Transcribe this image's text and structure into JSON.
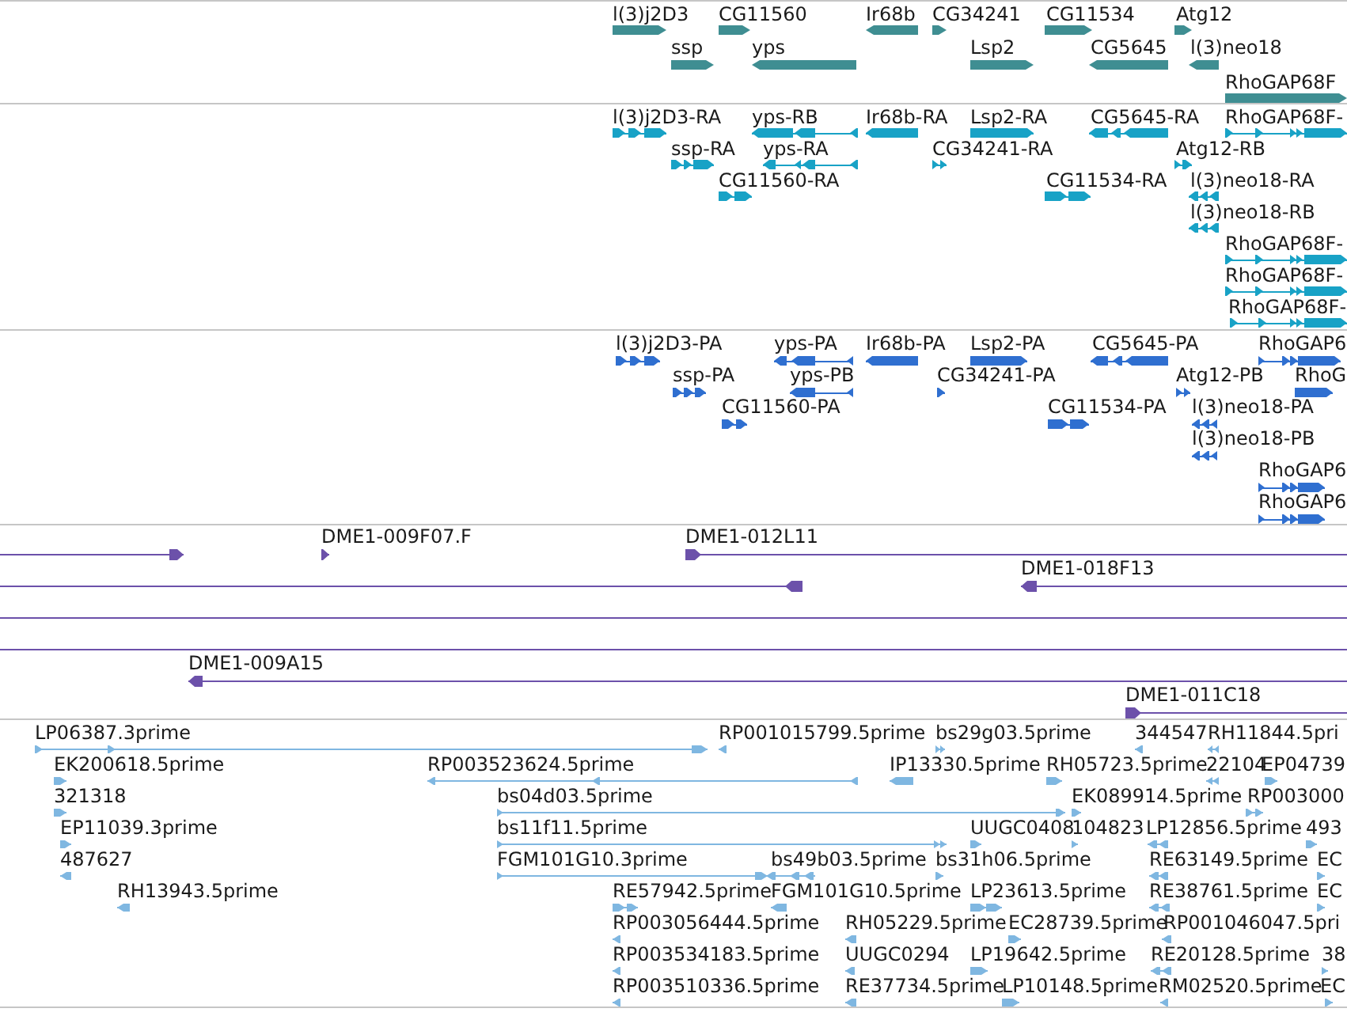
{
  "tracks": [
    {
      "kind": "gene",
      "features": [
        {
          "label": "l(3)j2D3",
          "reverse": false
        },
        {
          "label": "CG11560",
          "reverse": false
        },
        {
          "label": "Ir68b",
          "reverse": true
        },
        {
          "label": "CG34241",
          "reverse": false
        },
        {
          "label": "CG11534",
          "reverse": false
        },
        {
          "label": "Atg12",
          "reverse": false
        },
        {
          "label": "ssp",
          "reverse": false
        },
        {
          "label": "yps",
          "reverse": true
        },
        {
          "label": "Lsp2",
          "reverse": false
        },
        {
          "label": "CG5645",
          "reverse": true
        },
        {
          "label": "l(3)neo18",
          "reverse": true
        },
        {
          "label": "RhoGAP68F",
          "reverse": false
        }
      ]
    },
    {
      "kind": "transcript",
      "features": [
        {
          "label": "l(3)j2D3-RA",
          "reverse": false
        },
        {
          "label": "yps-RB",
          "reverse": true
        },
        {
          "label": "Ir68b-RA",
          "reverse": true
        },
        {
          "label": "Lsp2-RA",
          "reverse": false
        },
        {
          "label": "CG5645-RA",
          "reverse": true
        },
        {
          "label": "RhoGAP68F-",
          "reverse": false
        },
        {
          "label": "ssp-RA",
          "reverse": false
        },
        {
          "label": "yps-RA",
          "reverse": true
        },
        {
          "label": "CG34241-RA",
          "reverse": false
        },
        {
          "label": "Atg12-RB",
          "reverse": false
        },
        {
          "label": "CG11560-RA",
          "reverse": false
        },
        {
          "label": "CG11534-RA",
          "reverse": false
        },
        {
          "label": "l(3)neo18-RA",
          "reverse": true
        },
        {
          "label": "l(3)neo18-RB",
          "reverse": true
        },
        {
          "label": "RhoGAP68F-",
          "reverse": false
        },
        {
          "label": "RhoGAP68F-",
          "reverse": false
        },
        {
          "label": "RhoGAP68F-",
          "reverse": false
        }
      ]
    },
    {
      "kind": "protein",
      "features": [
        {
          "label": "l(3)j2D3-PA",
          "reverse": false
        },
        {
          "label": "yps-PA",
          "reverse": true
        },
        {
          "label": "Ir68b-PA",
          "reverse": true
        },
        {
          "label": "Lsp2-PA",
          "reverse": false
        },
        {
          "label": "CG5645-PA",
          "reverse": true
        },
        {
          "label": "RhoGAP6",
          "reverse": false
        },
        {
          "label": "ssp-PA",
          "reverse": false
        },
        {
          "label": "yps-PB",
          "reverse": true
        },
        {
          "label": "CG34241-PA",
          "reverse": false
        },
        {
          "label": "Atg12-PB",
          "reverse": false
        },
        {
          "label": "RhoG",
          "reverse": false
        },
        {
          "label": "CG11560-PA",
          "reverse": false
        },
        {
          "label": "CG11534-PA",
          "reverse": false
        },
        {
          "label": "l(3)neo18-PA",
          "reverse": true
        },
        {
          "label": "l(3)neo18-PB",
          "reverse": true
        },
        {
          "label": "RhoGAP6",
          "reverse": false
        },
        {
          "label": "RhoGAP6",
          "reverse": false
        }
      ]
    },
    {
      "kind": "clone",
      "features": [
        {
          "kind": "arrow",
          "reverse": false
        },
        {
          "kind": "arrow",
          "label": "DME1-009F07.F",
          "reverse": false
        },
        {
          "kind": "arrow",
          "label": "DME1-012L11",
          "reverse": false
        },
        {
          "kind": "arrow",
          "reverse": true
        },
        {
          "kind": "arrow",
          "label": "DME1-018F13",
          "reverse": true
        },
        {
          "kind": "line"
        },
        {
          "kind": "line"
        },
        {
          "kind": "arrow",
          "label": "DME1-009A15",
          "reverse": true
        },
        {
          "kind": "arrow",
          "label": "DME1-011C18",
          "reverse": false
        }
      ]
    },
    {
      "kind": "est",
      "features": [
        {
          "label": "LP06387.3prime",
          "reverse": false
        },
        {
          "label": "RP001015799.5prime",
          "reverse": true
        },
        {
          "label": "bs29g03.5prime",
          "reverse": false
        },
        {
          "label": "344547",
          "reverse": true
        },
        {
          "label": "RH11844.5pri",
          "reverse": true
        },
        {
          "label": "EK200618.5prime",
          "reverse": false
        },
        {
          "label": "RP003523624.5prime",
          "reverse": true
        },
        {
          "label": "IP13330.5prime",
          "reverse": true
        },
        {
          "label": "RH05723.5prime",
          "reverse": false
        },
        {
          "label": "22104",
          "reverse": true
        },
        {
          "label": "EP04739",
          "reverse": false
        },
        {
          "label": "321318",
          "reverse": false
        },
        {
          "label": "bs04d03.5prime",
          "reverse": false
        },
        {
          "label": "EK089914.5prime",
          "reverse": false
        },
        {
          "label": "RP003000",
          "reverse": false
        },
        {
          "label": "EP11039.3prime",
          "reverse": false
        },
        {
          "label": "bs11f11.5prime",
          "reverse": false
        },
        {
          "label": "UUGC0408",
          "reverse": false
        },
        {
          "label": "104823",
          "reverse": false
        },
        {
          "label": "LP12856.5prime",
          "reverse": true
        },
        {
          "label": "493",
          "reverse": false
        },
        {
          "label": "487627",
          "reverse": true
        },
        {
          "label": "FGM101G10.3prime",
          "reverse": false
        },
        {
          "label": "bs49b03.5prime",
          "reverse": true
        },
        {
          "label": "bs31h06.5prime",
          "reverse": false
        },
        {
          "label": "RE63149.5prime",
          "reverse": true
        },
        {
          "label": "EC",
          "reverse": false
        },
        {
          "label": "RH13943.5prime",
          "reverse": true
        },
        {
          "label": "RE57942.5prime",
          "reverse": false
        },
        {
          "label": "FGM101G10.5prime",
          "reverse": true
        },
        {
          "label": "LP23613.5prime",
          "reverse": false
        },
        {
          "label": "RE38761.5prime",
          "reverse": true
        },
        {
          "label": "EC",
          "reverse": false
        },
        {
          "label": "RP003056444.5prime",
          "reverse": true
        },
        {
          "label": "RH05229.5prime",
          "reverse": true
        },
        {
          "label": "EC28739.5prime",
          "reverse": false
        },
        {
          "label": "RP001046047.5pri",
          "reverse": true
        },
        {
          "label": "RP003534183.5prime",
          "reverse": true
        },
        {
          "label": "UUGC0294",
          "reverse": true
        },
        {
          "label": "LP19642.5prime",
          "reverse": false
        },
        {
          "label": "RE20128.5prime",
          "reverse": true
        },
        {
          "label": "38",
          "reverse": false
        },
        {
          "label": "RP003510336.5prime",
          "reverse": true
        },
        {
          "label": "RE37734.5prime",
          "reverse": true
        },
        {
          "label": "LP10148.5prime",
          "reverse": false
        },
        {
          "label": "RM02520.5prime",
          "reverse": true
        },
        {
          "label": "EC",
          "reverse": false
        }
      ]
    }
  ]
}
